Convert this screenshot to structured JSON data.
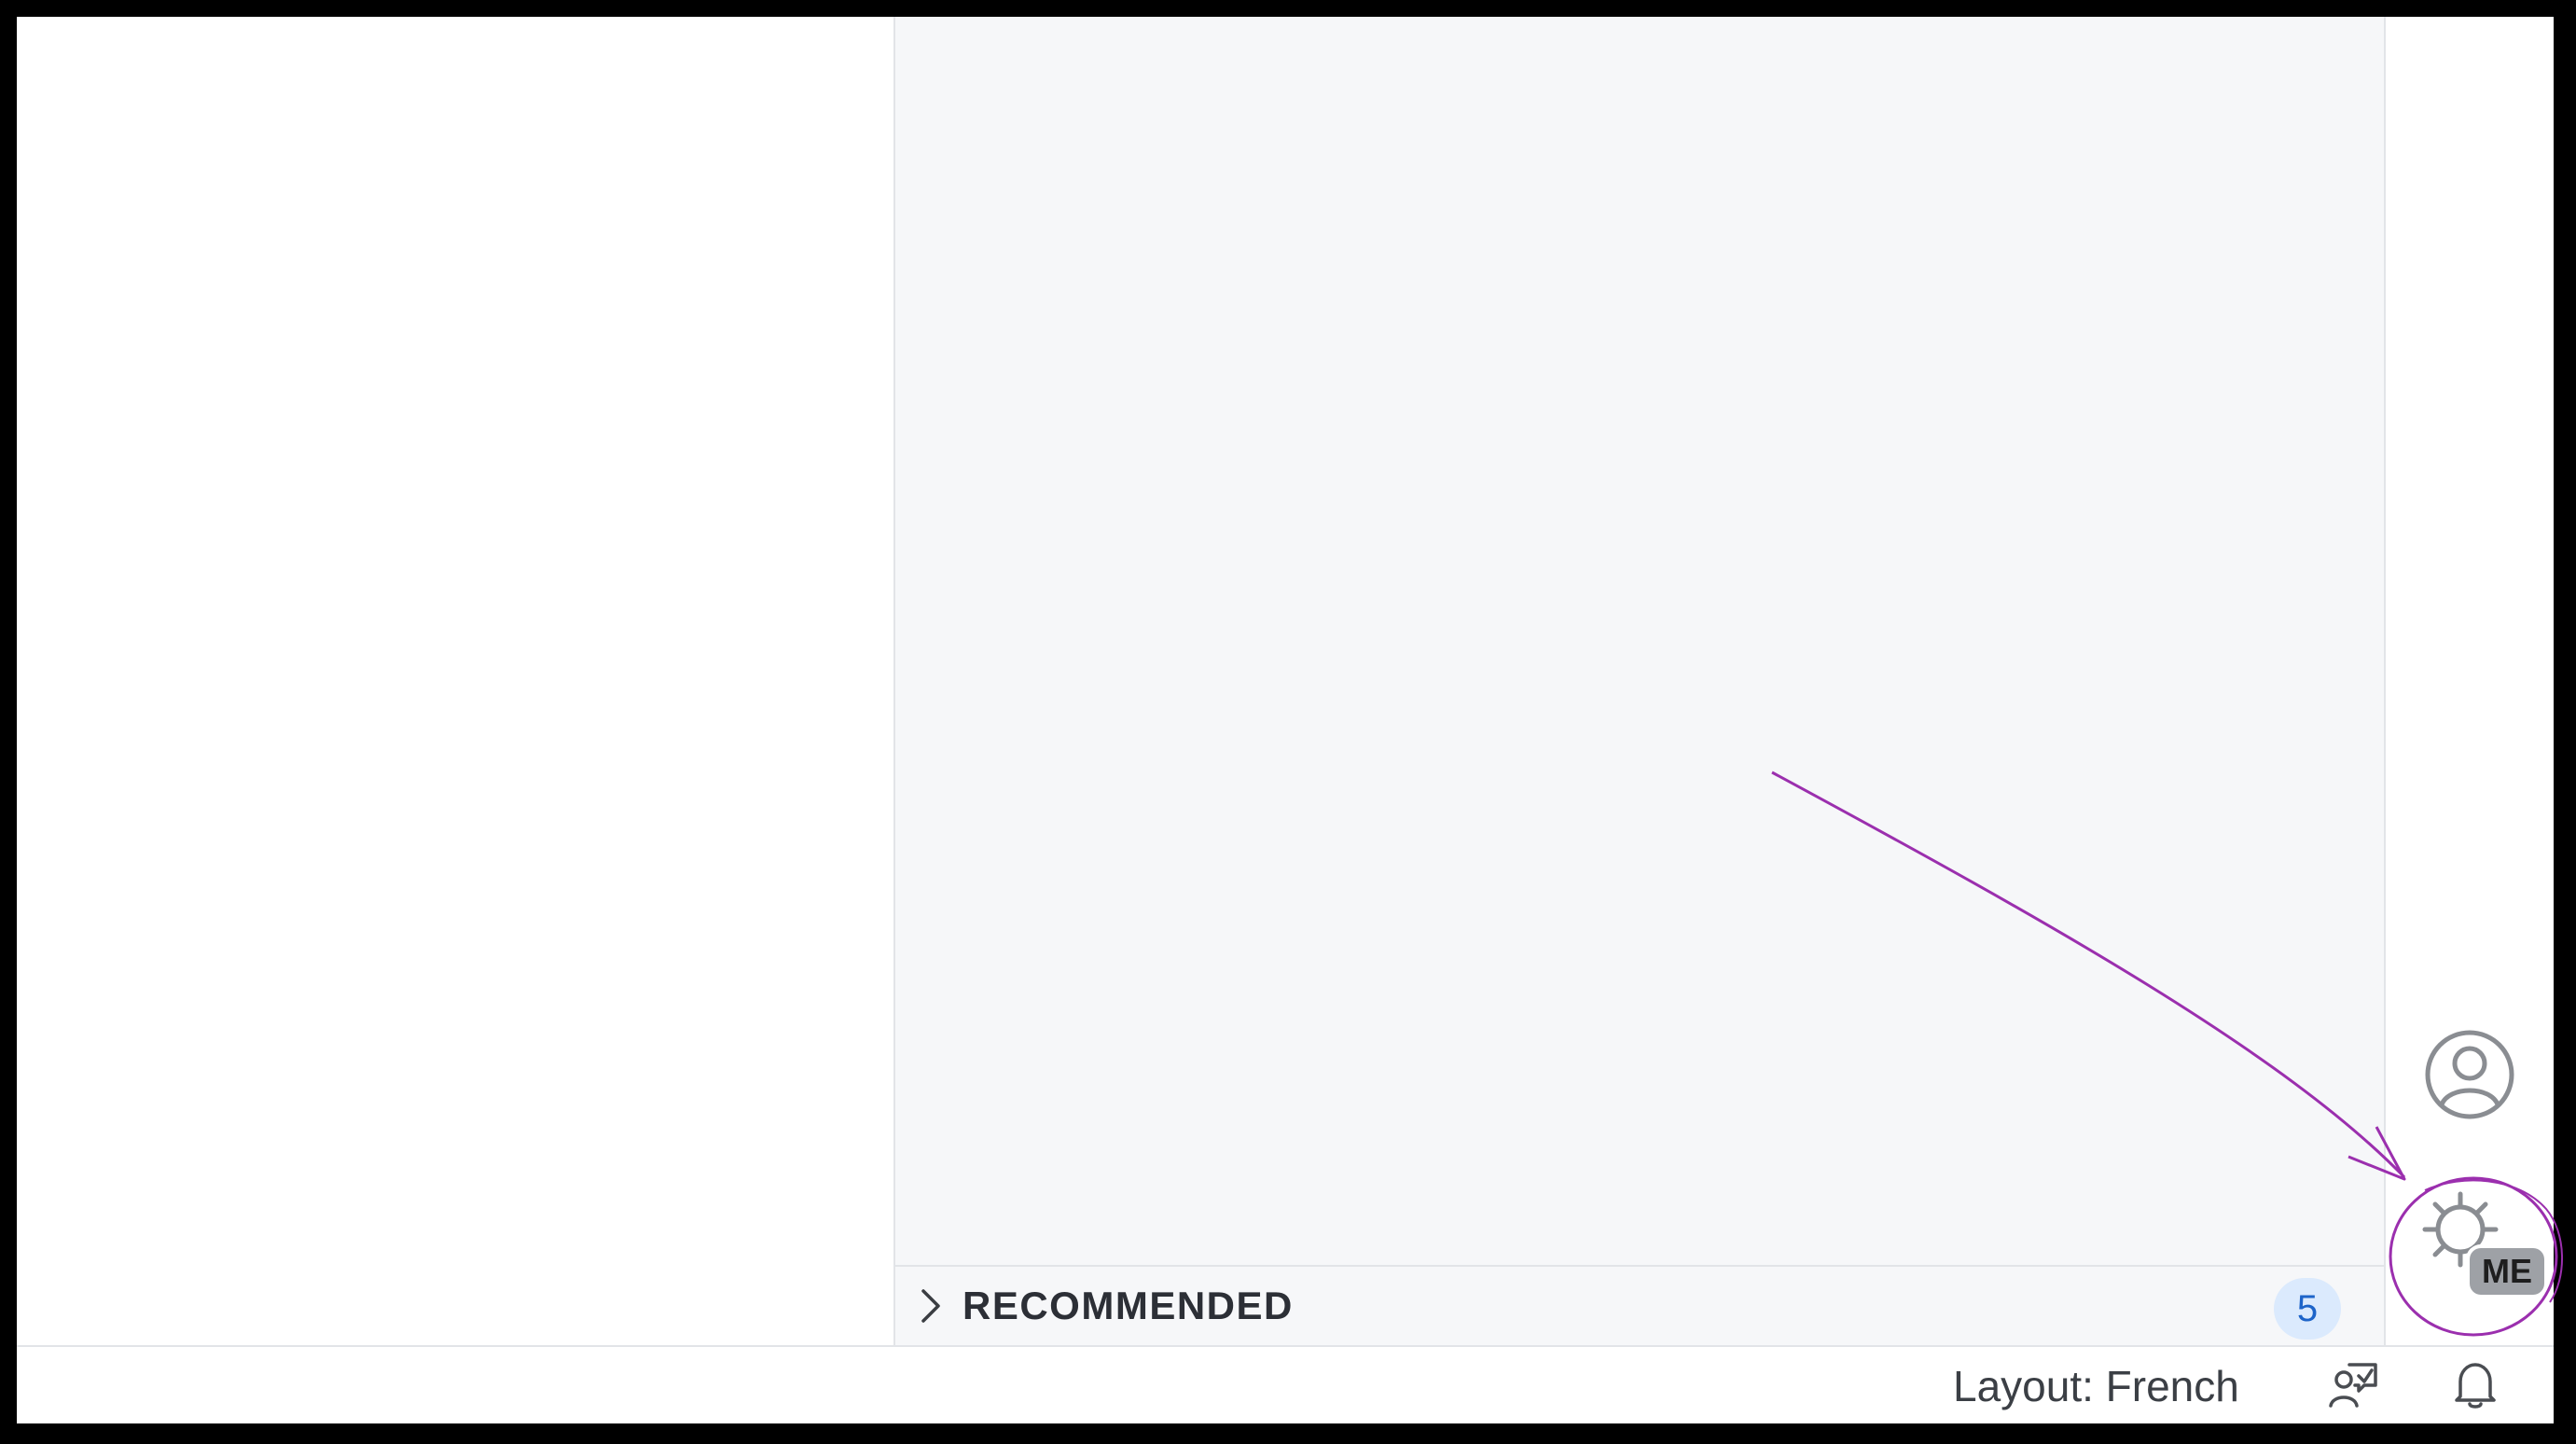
{
  "sidebar": {
    "recommended": {
      "label": "RECOMMENDED",
      "count": "5",
      "chevron_icon": "chevron-right-icon"
    }
  },
  "activity_bar": {
    "accounts_icon": "account-icon",
    "manage_icon": "gear-icon",
    "manage_badge": "ME"
  },
  "status_bar": {
    "layout_label": "Layout: French",
    "feedback_icon": "feedback-icon",
    "notifications_icon": "bell-icon"
  },
  "annotation": {
    "color": "#9b2fae",
    "shapes": [
      "arrow",
      "circle"
    ]
  },
  "colors": {
    "panel_background": "#f6f7f9",
    "badge_background": "#dbeafd",
    "badge_text": "#1d64c9",
    "frame": "#000000"
  }
}
